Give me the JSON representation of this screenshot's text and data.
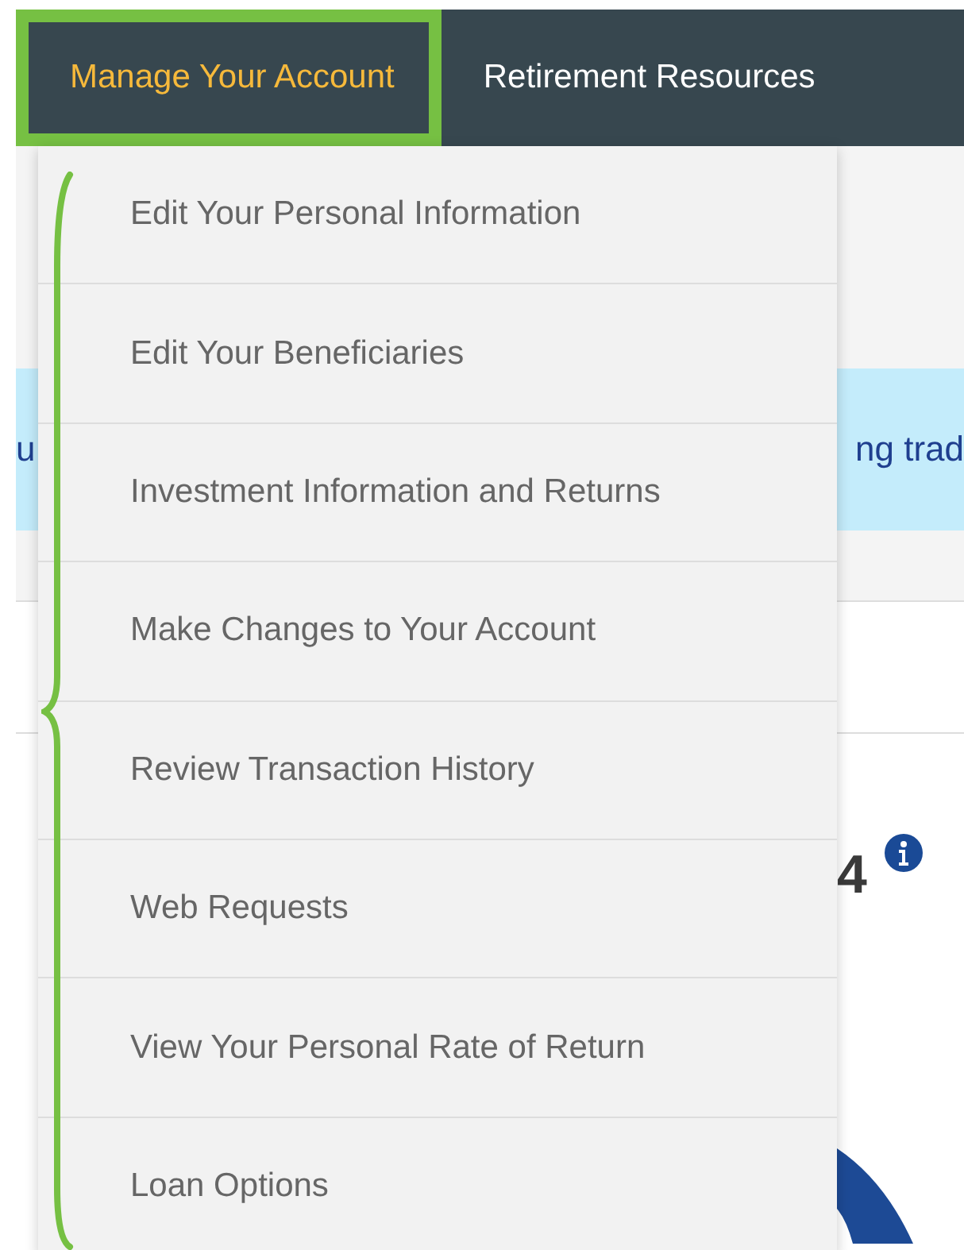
{
  "nav": {
    "tabs": [
      {
        "label": "Manage Your Account",
        "selected": true
      },
      {
        "label": "Retirement Resources",
        "selected": false
      }
    ]
  },
  "menu": {
    "items": [
      {
        "label": "Edit Your Personal Information"
      },
      {
        "label": "Edit Your Beneficiaries"
      },
      {
        "label": "Investment Information and Returns"
      },
      {
        "label": "Make Changes to Your Account"
      },
      {
        "label": "Review Transaction History"
      },
      {
        "label": "Web Requests"
      },
      {
        "label": "View Your Personal Rate of Return"
      },
      {
        "label": "Loan Options"
      }
    ]
  },
  "banner": {
    "text_left": "u",
    "text_right": "ng trad"
  },
  "balance": {
    "amount_fragment": "4"
  }
}
